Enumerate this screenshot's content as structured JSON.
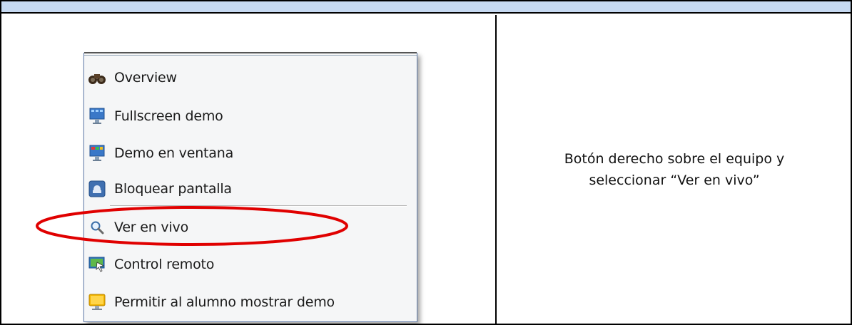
{
  "menu": {
    "items": [
      {
        "label": "Overview",
        "icon": "binoculars-icon"
      },
      {
        "label": "Fullscreen demo",
        "icon": "monitor-fullscreen-icon"
      },
      {
        "label": "Demo en ventana",
        "icon": "monitor-window-icon"
      },
      {
        "label": "Bloquear pantalla",
        "icon": "lock-screen-icon"
      },
      {
        "label": "Ver en vivo",
        "icon": "magnifier-icon"
      },
      {
        "label": "Control remoto",
        "icon": "remote-control-icon"
      },
      {
        "label": "Permitir al alumno mostrar demo",
        "icon": "student-monitor-icon"
      }
    ]
  },
  "caption": {
    "line1": "Botón derecho sobre el equipo y",
    "line2": "seleccionar “Ver en vivo”"
  },
  "colors": {
    "header_fill": "#c6d9f1",
    "highlight": "#e00000",
    "menu_border": "#5f7aa8"
  }
}
